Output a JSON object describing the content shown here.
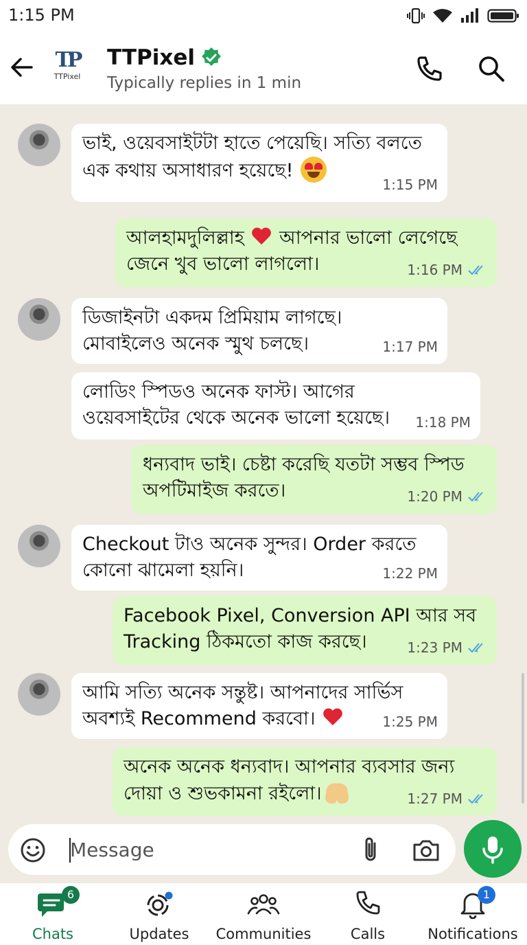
{
  "status_bar": {
    "time": "1:15 PM"
  },
  "header": {
    "logo_mark": "TP",
    "logo_text": "TTPixel",
    "name": "TTPixel",
    "subtitle": "Typically replies in 1 min"
  },
  "messages": [
    {
      "dir": "in",
      "line1": "ভাই, ওয়েবসাইটটা হাতে পেয়েছি। সত্যি বলতে",
      "line2": "এক কথায় অসাধারণ হয়েছে!",
      "emoji": "smiling-face-with-heart-eyes",
      "time": "1:15 PM"
    },
    {
      "dir": "out",
      "line1": "আলহামদুলিল্লাহ",
      "line1b": "আপনার ভালো লেগেছে",
      "emoji": "red-heart",
      "line2": "জেনে খুব ভালো লাগলো।",
      "time": "1:16 PM"
    },
    {
      "dir": "in",
      "line1": "ডিজাইনটা একদম প্রিমিয়াম লাগছে।",
      "line2": "মোবাইলেও অনেক স্মুথ চলছে।",
      "time": "1:17 PM"
    },
    {
      "dir": "in",
      "line1": "লোডিং স্পিডও অনেক ফাস্ট। আগের",
      "line2": "ওয়েবসাইটের থেকে অনেক ভালো হয়েছে।",
      "time": "1:18 PM"
    },
    {
      "dir": "out",
      "line1": "ধন্যবাদ ভাই। চেষ্টা করেছি যতটা সম্ভব স্পিড",
      "line2": "অপটিমাইজ করতে।",
      "time": "1:20 PM"
    },
    {
      "dir": "in",
      "line1": "Checkout টাও অনেক সুন্দর। Order করতে",
      "line2": "কোনো ঝামেলা হয়নি।",
      "time": "1:22 PM"
    },
    {
      "dir": "out",
      "line1": "Facebook Pixel, Conversion API আর সব",
      "line2": "Tracking ঠিকমতো কাজ করছে।",
      "time": "1:23 PM"
    },
    {
      "dir": "in",
      "line1": "আমি সত্যি অনেক সন্তুষ্ট। আপনাদের সার্ভিস",
      "line2": "অবশ্যই Recommend করবো।",
      "emoji": "red-heart",
      "time": "1:25 PM"
    },
    {
      "dir": "out",
      "line1": "অনেক অনেক ধন্যবাদ। আপনার ব্যবসার জন্য",
      "line2": "দোয়া ও শুভকামনা রইলো।",
      "emoji": "folded-hands",
      "time": "1:27 PM"
    }
  ],
  "composer": {
    "placeholder": "Message"
  },
  "nav": {
    "chats": {
      "label": "Chats",
      "badge": "6"
    },
    "updates": {
      "label": "Updates"
    },
    "communities": {
      "label": "Communities"
    },
    "calls": {
      "label": "Calls"
    },
    "notifications": {
      "label": "Notifications",
      "badge": "1"
    }
  },
  "colors": {
    "accent_green": "#1da851",
    "outgoing_bubble": "#dcf8c6",
    "chat_background": "#efeae2",
    "read_ticks": "#4fa3e0"
  }
}
